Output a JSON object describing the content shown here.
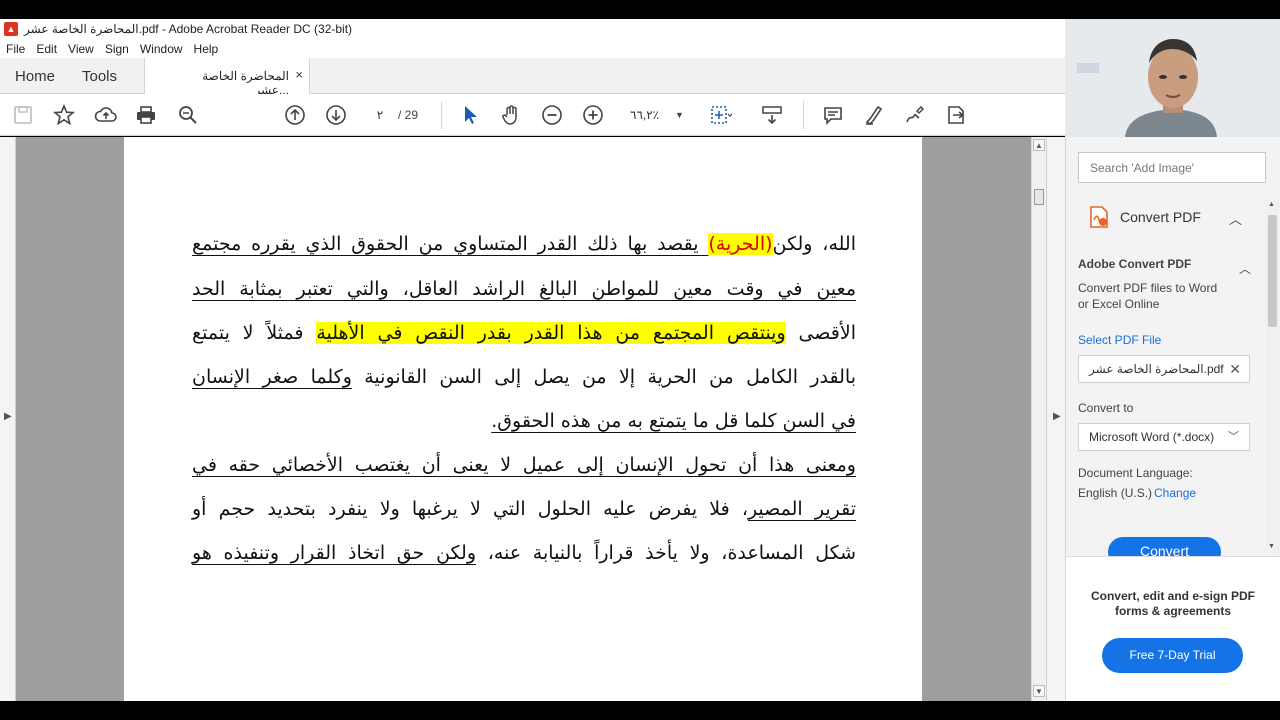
{
  "window": {
    "title": "المحاضرة الخاصة عشر.pdf - Adobe Acrobat Reader DC (32-bit)",
    "icon": "pdf-icon",
    "minimize": "—",
    "maximize": "☐"
  },
  "menu": [
    "File",
    "Edit",
    "View",
    "Sign",
    "Window",
    "Help"
  ],
  "tabs": {
    "home": "Home",
    "tools": "Tools",
    "document": "المحاضرة الخاصة عشر...",
    "close": "×"
  },
  "toolbar": {
    "page_current": "٢",
    "page_total": "/ 29",
    "zoom": "٦٦,٢٪"
  },
  "document": {
    "lines": [
      {
        "parts": [
          {
            "t": "الله، ولكن",
            "s": ""
          },
          {
            "t": "(الحرية)",
            "s": "hl red"
          },
          {
            "t": " يقصد بها ذلك القدر المتساوي من الحقوق الذي يقرره مجتمع",
            "s": "u"
          }
        ]
      },
      {
        "parts": [
          {
            "t": "معين في وقت معين للمواطن البالغ الراشد العاقل، والتي تعتبر بمثابة الحد",
            "s": "u"
          }
        ]
      },
      {
        "parts": [
          {
            "t": "الأقصى ",
            "s": ""
          },
          {
            "t": "وينتقص المجتمع من هذا القدر بقدر النقص في الأهلية",
            "s": "hl"
          },
          {
            "t": " فمثلاً لا يتمتع",
            "s": ""
          }
        ]
      },
      {
        "parts": [
          {
            "t": "بالقدر الكامل من الحرية إلا من يصل إلى السن القانونية ",
            "s": ""
          },
          {
            "t": "وكلما صغر الإنسان",
            "s": "u"
          }
        ]
      },
      {
        "parts": [
          {
            "t": "في السن كلما قل ما يتمتع به من هذه الحقوق.",
            "s": "u"
          }
        ]
      },
      {
        "parts": [
          {
            "t": "ومعنى هذا أن تحول الإنسان إلى عميل لا يعنى أن يغتصب الأخصائي حقه في",
            "s": "u"
          }
        ]
      },
      {
        "parts": [
          {
            "t": "تقرير المصير",
            "s": "u"
          },
          {
            "t": "، فلا يفرض عليه الحلول التي لا يرغبها ولا ينفرد بتحديد حجم أو",
            "s": ""
          }
        ]
      },
      {
        "parts": [
          {
            "t": "شكل المساعدة، ولا يأخذ قراراً بالنيابة عنه، ",
            "s": ""
          },
          {
            "t": "ولكن حق اتخاذ القرار وتنفيذه هو",
            "s": "u"
          }
        ]
      }
    ]
  },
  "right_pane": {
    "search_placeholder": "Search 'Add Image'",
    "convert_title": "Convert PDF",
    "section_title": "Adobe Convert PDF",
    "section_desc_1": "Convert PDF files to Word",
    "section_desc_2": "or Excel Online",
    "select_label": "Select PDF File",
    "selected_file": "المحاضرة الخاصة عشر.pdf",
    "convert_to_label": "Convert to",
    "convert_to_value": "Microsoft Word (*.docx)",
    "doc_lang_label": "Document Language:",
    "doc_lang_value": "English (U.S.)",
    "change_link": "Change",
    "convert_button": "Convert",
    "promo_text": "Convert, edit and e-sign PDF forms & agreements",
    "trial_button": "Free 7-Day Trial"
  },
  "colors": {
    "accent": "#1473e6",
    "highlight": "#ffff00",
    "red_text": "#e00000",
    "doc_bg": "#9e9e9e"
  }
}
